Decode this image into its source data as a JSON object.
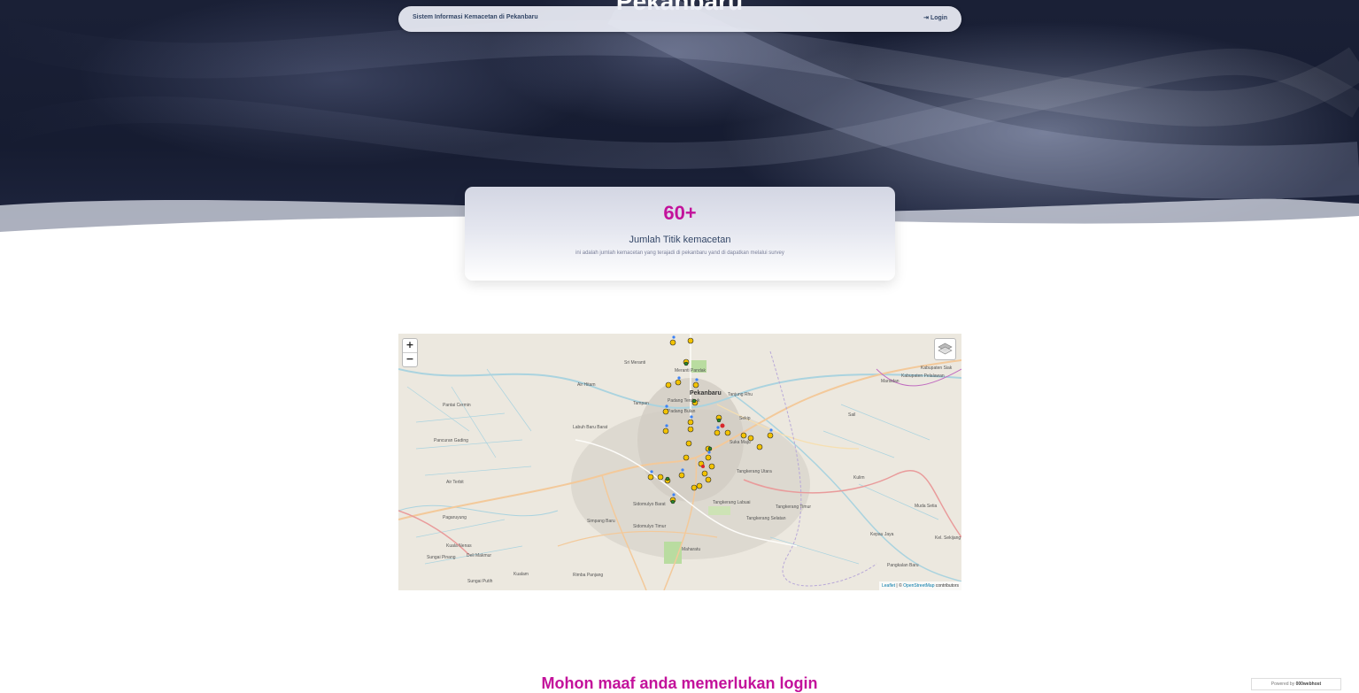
{
  "hero": {
    "title": "Pekanbaru"
  },
  "navbar": {
    "brand": "Sistem Informasi Kemacetan di Pekanbaru",
    "login_icon": "login-icon",
    "login_label": "Login"
  },
  "stat_card": {
    "value": "60+",
    "label": "Jumlah Titik kemacetan",
    "description": "ini adalah jumlah kemacetan yang terajadi di pekanbaru yand di dapatkan melalui survey"
  },
  "map": {
    "zoom_in": "+",
    "zoom_out": "−",
    "layers_icon": "layers-icon",
    "attribution_leaflet": "Leaflet",
    "attribution_sep": " | © ",
    "attribution_osm": "OpenStreetMap",
    "attribution_contrib": " contributors",
    "labels": {
      "pekanbaru": "Pekanbaru",
      "sri_meranti": "Sri Meranti",
      "air_hitam": "Air Hitam",
      "tampan": "Tampan",
      "padang_terubuk": "Padang Terubuk",
      "padang_bulan": "Padang Bulan",
      "labuh_baru_barat": "Labuh Baru Barat",
      "pantai_cermin": "Pantai Cermin",
      "pancuran_gading": "Pancuran Gading",
      "air_terbit": "Air Terbit",
      "pagaruyung": "Pagaruyung",
      "kuala_nenas": "Kuala Nenas",
      "sungai_pinang": "Sungai Pinang",
      "deli_makmur": "Deli Makmur",
      "sungai_putih": "Sungai Putih",
      "kualam": "Kualam",
      "rimba_panjang": "Rimba Panjang",
      "simpang_baru": "Simpang Baru",
      "sidomulyo_barat": "Sidomulyo Barat",
      "sidomulyo_timur": "Sidomulyo Timur",
      "maharatu": "Maharatu",
      "tangkerang_labuai": "Tangkerang Labuai",
      "tangkerang_utara": "Tangkerang Utara",
      "tangkerang_selatan": "Tangkerang Selatan",
      "tangkerang_timur": "Tangkerang Timur",
      "sukamaju": "Suka Maju",
      "sail": "Sail",
      "tanjung_rhu": "Tanjung Rhu",
      "sekip": "Sekip",
      "meranti_pandak": "Meranti Pandak",
      "marsidan": "Marsidan",
      "kulim": "Kulim",
      "muda_setia": "Muda Setia",
      "kepau_jaya": "Kepau Jaya",
      "kel_sekijang": "Kel. Sekijang",
      "pangkalan_baru": "Pangkalan Baru",
      "kabupaten_siak": "Kabupaten Siak",
      "kabupaten_pelalawan": "Kabupaten Pelalawan"
    }
  },
  "bottom": {
    "heading": "Mohon maaf anda memerlukan login"
  },
  "footer_badge": {
    "prefix": "Powered by ",
    "brand": "000webhost"
  },
  "colors": {
    "accent": "#c3129b",
    "text": "#344767",
    "muted": "#7b809a"
  }
}
